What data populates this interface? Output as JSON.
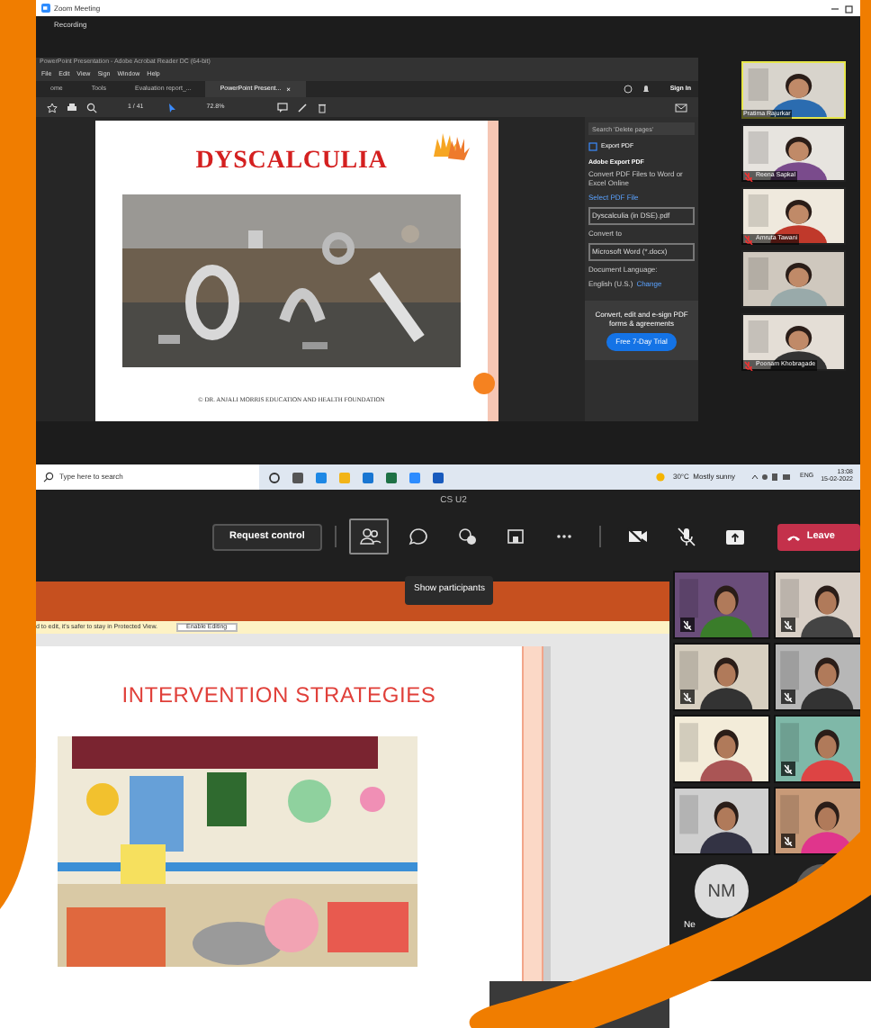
{
  "zoom_window": {
    "title": "Zoom Meeting",
    "recording": "Recording",
    "acrobat": {
      "title": "PowerPoint Presentation - Adobe Acrobat Reader DC (64-bit)",
      "menu": [
        "File",
        "Edit",
        "View",
        "Sign",
        "Window",
        "Help"
      ],
      "tabs": [
        {
          "label": "ome",
          "selected": false
        },
        {
          "label": "Tools",
          "selected": false
        },
        {
          "label": "Evaluation report_...",
          "selected": false
        },
        {
          "label": "PowerPoint Present...",
          "selected": true
        }
      ],
      "close_tab": "×",
      "sign_in": "Sign In",
      "page": "1 / 41",
      "zoom_level": "72.8%",
      "slide": {
        "title": "DYSCALCULIA",
        "footer": "© DR. ANJALI MORRIS EDUCATION AND HEALTH FOUNDATION"
      },
      "panel": {
        "search_placeholder": "Search 'Delete pages'",
        "export": "Export PDF",
        "heading": "Adobe Export PDF",
        "description": "Convert PDF Files to Word or Excel Online",
        "select_label": "Select PDF File",
        "file": "Dyscalculia (in DSE).pdf",
        "convert_label": "Convert to",
        "format": "Microsoft Word (*.docx)",
        "language_label": "Document Language:",
        "language": "English (U.S.)",
        "change": "Change",
        "promo": "Convert, edit and e-sign PDF forms & agreements",
        "trial": "Free 7-Day Trial"
      }
    },
    "participants": [
      {
        "name": "Pratima Rajurkar",
        "speaking": true,
        "muted": false
      },
      {
        "name": "Reena Sapkal",
        "speaking": false,
        "muted": true
      },
      {
        "name": "Amruta Tawani",
        "speaking": false,
        "muted": true
      },
      {
        "speaking": false,
        "muted": false
      },
      {
        "name": "Poonam Khobragade",
        "speaking": false,
        "muted": true
      }
    ],
    "taskbar": {
      "search_placeholder": "Type here to search",
      "weather": "30°C  Mostly sunny",
      "language": "ENG",
      "time": "13:08",
      "date": "15-02-2022"
    }
  },
  "teams_window": {
    "title": "CS U2",
    "request_control": "Request control",
    "toolbar": [
      {
        "kind": "participants",
        "selected": true
      },
      {
        "kind": "chat",
        "selected": false
      },
      {
        "kind": "reactions",
        "selected": false
      },
      {
        "kind": "rooms",
        "selected": false
      },
      {
        "kind": "more",
        "selected": false
      },
      {
        "kind": "camera_off",
        "selected": false
      },
      {
        "kind": "mic_off",
        "selected": false
      },
      {
        "kind": "share",
        "selected": false
      }
    ],
    "leave": "Leave",
    "tooltip": "Show participants",
    "powerpoint": {
      "protected_message": "d to edit, it's safer to stay in Protected View.",
      "enable_editing": "Enable Editing",
      "slide_title": "INTERVENTION STRATEGIES"
    },
    "videos": [
      {
        "kind": "video",
        "muted": true
      },
      {
        "kind": "video",
        "muted": true
      },
      {
        "kind": "video",
        "muted": true
      },
      {
        "kind": "video",
        "muted": true
      },
      {
        "kind": "video",
        "muted": false
      },
      {
        "kind": "video",
        "muted": true
      },
      {
        "kind": "video",
        "muted": false
      },
      {
        "kind": "video",
        "muted": true
      },
      {
        "kind": "avatar",
        "initials": "NM",
        "name": "Ne"
      },
      {
        "kind": "avatar"
      }
    ]
  }
}
